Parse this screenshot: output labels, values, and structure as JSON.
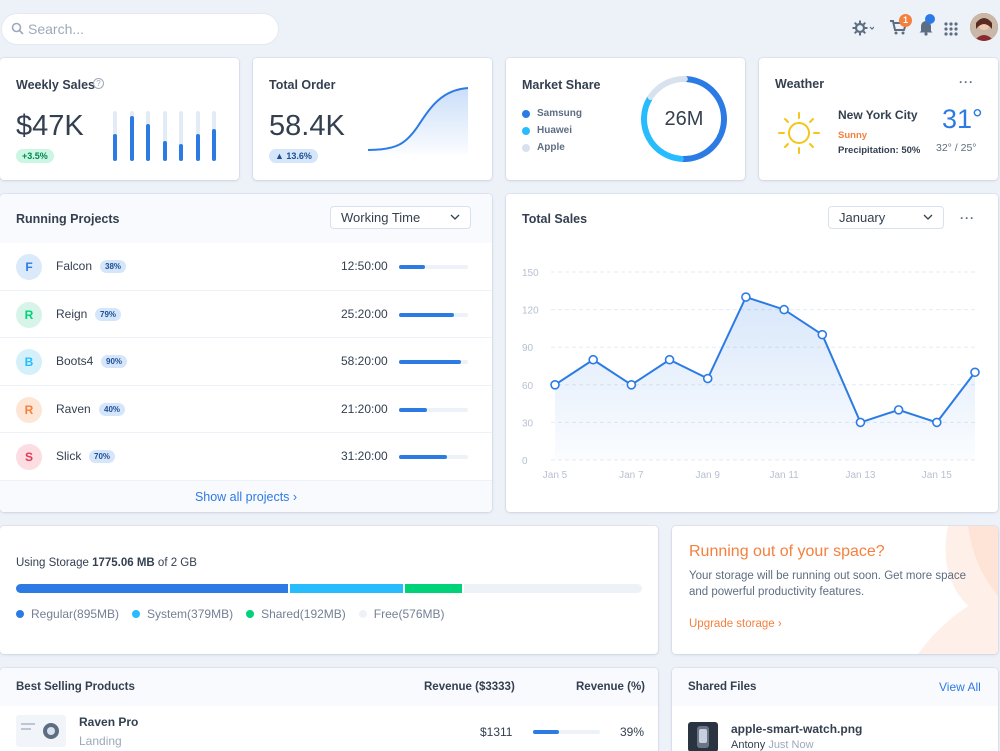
{
  "topbar": {
    "search_placeholder": "Search...",
    "cart_count": "1"
  },
  "weekly_sales": {
    "title": "Weekly Sales",
    "value": "$47K",
    "change": "+3.5%",
    "bars": [
      0.55,
      0.9,
      0.75,
      0.4,
      0.35,
      0.55,
      0.65
    ]
  },
  "total_order": {
    "title": "Total Order",
    "value": "58.4K",
    "change": "▲ 13.6%"
  },
  "market_share": {
    "title": "Market Share",
    "center": "26M",
    "legend": [
      {
        "label": "Samsung",
        "color": "#2c7be5"
      },
      {
        "label": "Huawei",
        "color": "#27bcfd"
      },
      {
        "label": "Apple",
        "color": "#d8e2ef"
      }
    ],
    "slices": [
      0.5,
      0.33,
      0.17
    ]
  },
  "weather": {
    "title": "Weather",
    "city": "New York City",
    "condition": "Sunny",
    "precipitation": "Precipitation: 50%",
    "temp": "31°",
    "range": "32° / 25°"
  },
  "running_projects": {
    "title": "Running Projects",
    "filter": "Working Time",
    "footer": "Show all projects ›",
    "items": [
      {
        "initial": "F",
        "name": "Falcon",
        "percent": "38%",
        "time": "12:50:00",
        "fraction": 0.38,
        "bg": "#dbeafb",
        "fg": "#2c7be5"
      },
      {
        "initial": "R",
        "name": "Reign",
        "percent": "79%",
        "time": "25:20:00",
        "fraction": 0.79,
        "bg": "#d6f5e8",
        "fg": "#00d27a"
      },
      {
        "initial": "B",
        "name": "Boots4",
        "percent": "90%",
        "time": "58:20:00",
        "fraction": 0.9,
        "bg": "#d4f0fb",
        "fg": "#27bcfd"
      },
      {
        "initial": "R",
        "name": "Raven",
        "percent": "40%",
        "time": "21:20:00",
        "fraction": 0.4,
        "bg": "#fde6d6",
        "fg": "#f5803e"
      },
      {
        "initial": "S",
        "name": "Slick",
        "percent": "70%",
        "time": "31:20:00",
        "fraction": 0.7,
        "bg": "#fcdde2",
        "fg": "#e63757"
      }
    ]
  },
  "total_sales": {
    "title": "Total Sales",
    "month": "January"
  },
  "chart_data": {
    "type": "line",
    "title": "Total Sales",
    "x": [
      "Jan 5",
      "Jan 6",
      "Jan 7",
      "Jan 8",
      "Jan 9",
      "Jan 10",
      "Jan 11",
      "Jan 12",
      "Jan 13",
      "Jan 14",
      "Jan 15",
      "Jan 16"
    ],
    "xtick_labels": [
      "Jan 5",
      "Jan 7",
      "Jan 9",
      "Jan 11",
      "Jan 13",
      "Jan 15"
    ],
    "yticks": [
      "150",
      "120",
      "90",
      "60",
      "30",
      "0"
    ],
    "values": [
      60,
      80,
      60,
      80,
      65,
      130,
      120,
      100,
      30,
      40,
      30,
      70
    ],
    "ylim": [
      0,
      150
    ],
    "grid": true
  },
  "storage": {
    "label_prefix": "Using Storage ",
    "used": "1775.06 MB",
    "label_suffix": " of 2 GB",
    "segments": [
      {
        "label": "Regular(895MB)",
        "fraction": 0.437,
        "color": "#2c7be5"
      },
      {
        "label": "System(379MB)",
        "fraction": 0.185,
        "color": "#27bcfd"
      },
      {
        "label": "Shared(192MB)",
        "fraction": 0.094,
        "color": "#00d27a"
      },
      {
        "label": "Free(576MB)",
        "fraction": 0.284,
        "color": "#edf2f9"
      }
    ]
  },
  "space_promo": {
    "title": "Running out of your space?",
    "body": "Your storage will be running out soon. Get more space and powerful productivity features.",
    "link": "Upgrade storage ›"
  },
  "best_selling": {
    "title": "Best Selling Products",
    "col1": "Revenue ($3333)",
    "col2": "Revenue (%)",
    "rows": [
      {
        "name": "Raven Pro",
        "category": "Landing",
        "revenue": "$1311",
        "percent": "39%",
        "fraction": 0.39
      }
    ]
  },
  "shared_files": {
    "title": "Shared Files",
    "view_all": "View All",
    "files": [
      {
        "name": "apple-smart-watch.png",
        "user": "Antony",
        "time": "Just Now"
      }
    ]
  }
}
